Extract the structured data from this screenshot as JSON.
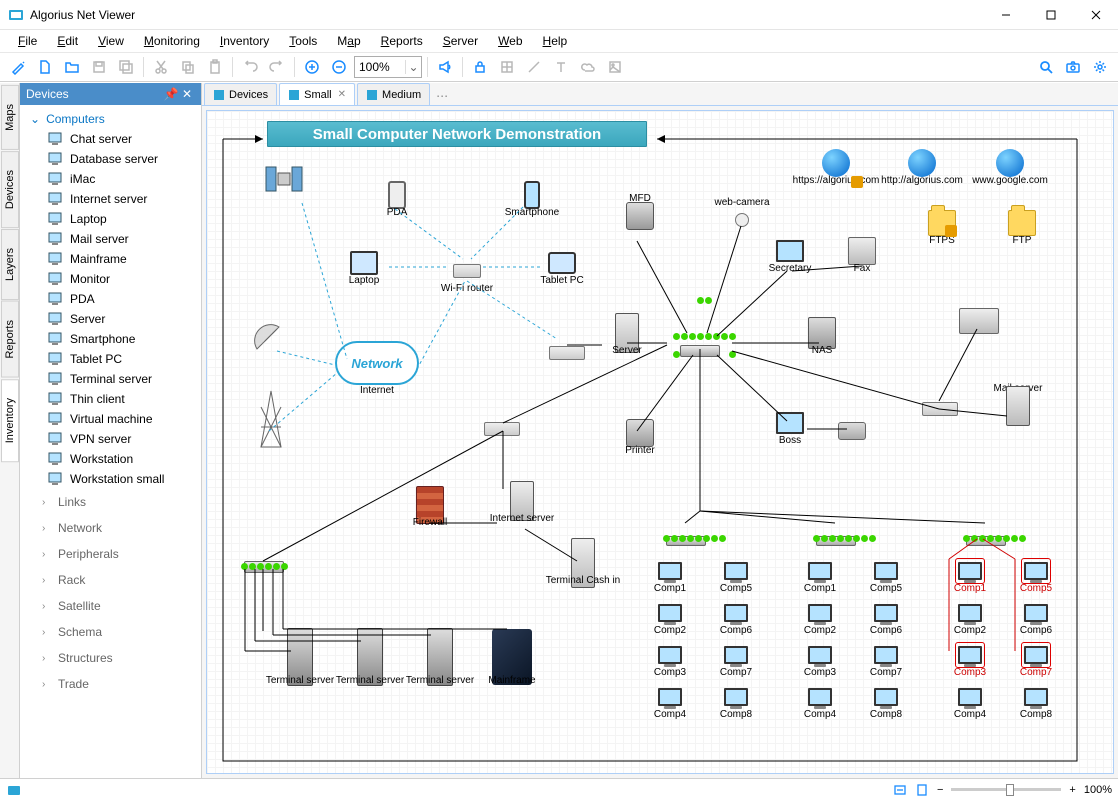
{
  "app": {
    "title": "Algorius Net Viewer"
  },
  "menu": [
    {
      "label": "File",
      "u": "F"
    },
    {
      "label": "Edit",
      "u": "E"
    },
    {
      "label": "View",
      "u": "V"
    },
    {
      "label": "Monitoring",
      "u": "M"
    },
    {
      "label": "Inventory",
      "u": "I"
    },
    {
      "label": "Tools",
      "u": "T"
    },
    {
      "label": "Map",
      "u": "a"
    },
    {
      "label": "Reports",
      "u": "R"
    },
    {
      "label": "Server",
      "u": "S"
    },
    {
      "label": "Web",
      "u": "W"
    },
    {
      "label": "Help",
      "u": "H"
    }
  ],
  "toolbar": {
    "zoom": "100%"
  },
  "vtabs": [
    "Maps",
    "Devices",
    "Layers",
    "Reports",
    "Inventory"
  ],
  "sidebar": {
    "title": "Devices",
    "group": "Computers",
    "items": [
      "Chat server",
      "Database server",
      "iMac",
      "Internet server",
      "Laptop",
      "Mail server",
      "Mainframe",
      "Monitor",
      "PDA",
      "Server",
      "Smartphone",
      "Tablet PC",
      "Terminal server",
      "Thin client",
      "Virtual machine",
      "VPN server",
      "Workstation",
      "Workstation small"
    ],
    "subgroups": [
      "Links",
      "Network",
      "Peripherals",
      "Rack",
      "Satellite",
      "Schema",
      "Structures",
      "Trade"
    ]
  },
  "tabs": [
    {
      "label": "Devices",
      "active": false
    },
    {
      "label": "Small",
      "active": true,
      "closable": true
    },
    {
      "label": "Medium",
      "active": false
    }
  ],
  "canvas": {
    "banner": "Small Computer Network Demonstration",
    "web_links": [
      "https://algorius.com",
      "http://algorius.com",
      "www.google.com"
    ],
    "folders": [
      "FTPS",
      "FTP"
    ],
    "nodes": {
      "pda": "PDA",
      "smartphone": "Smartphone",
      "laptop": "Laptop",
      "wifi": "Wi-Fi router",
      "tablet": "Tablet PC",
      "mfd": "MFD",
      "webcam": "web-camera",
      "secretary": "Secretary",
      "fax": "Fax",
      "server": "Server",
      "nas": "NAS",
      "mail": "Mail server",
      "internet": "Internet",
      "internet_server": "Internet server",
      "firewall": "Firewall",
      "printer": "Printer",
      "boss": "Boss",
      "terminal_cash": "Terminal Cash in",
      "mainframe": "Mainframe",
      "terminal_server": "Terminal server",
      "network_cloud": "Network"
    },
    "comp_groups": {
      "g1": [
        "Comp1",
        "Comp2",
        "Comp3",
        "Comp4",
        "Comp5",
        "Comp6",
        "Comp7",
        "Comp8"
      ],
      "g2": [
        "Comp1",
        "Comp2",
        "Comp3",
        "Comp4",
        "Comp5",
        "Comp6",
        "Comp7",
        "Comp8"
      ],
      "g3": [
        "Comp1",
        "Comp2",
        "Comp3",
        "Comp4",
        "Comp5",
        "Comp6",
        "Comp7",
        "Comp8"
      ],
      "g3_red": [
        "Comp1",
        "Comp3",
        "Comp5",
        "Comp7"
      ]
    }
  },
  "status": {
    "zoom": "100%"
  }
}
